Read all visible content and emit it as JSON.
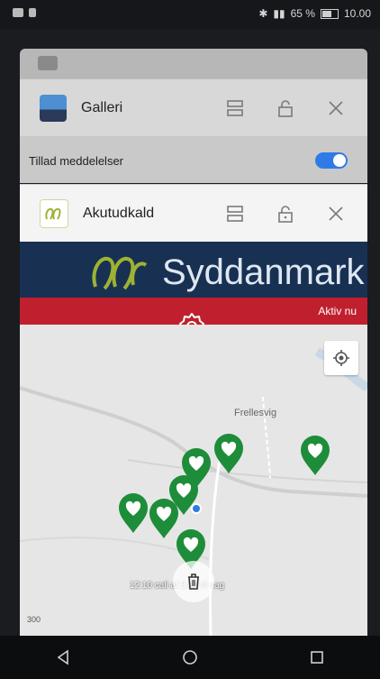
{
  "status_bar": {
    "right_text": "65 % ",
    "time": "10.00"
  },
  "recents": {
    "cards": [
      {
        "app_name": "Galleri",
        "icon": "gallery-icon",
        "settings": {
          "label": "Tillad meddelelser",
          "enabled": true
        }
      },
      {
        "app_name": "Akutudkald",
        "icon": "akutudkald-icon",
        "content": {
          "logo_text": "Syddanmark",
          "status_label": "Aktiv nu",
          "map": {
            "place_label": "Frellesvig",
            "scale_label": "300",
            "overlay_text": "12:10 cali af 3,00 til sag"
          }
        }
      }
    ]
  },
  "colors": {
    "brand_red": "#c0202e",
    "brand_blue": "#183152",
    "pin_green": "#1d8d3a",
    "toggle_blue": "#2f7be6"
  },
  "icons": {
    "split": "split-screen-icon",
    "lock": "lock-icon",
    "close": "close-icon",
    "gear": "gear-icon",
    "locate": "locate-icon",
    "trash": "trash-icon",
    "back": "back-icon",
    "home": "home-icon",
    "recents": "recents-icon"
  }
}
